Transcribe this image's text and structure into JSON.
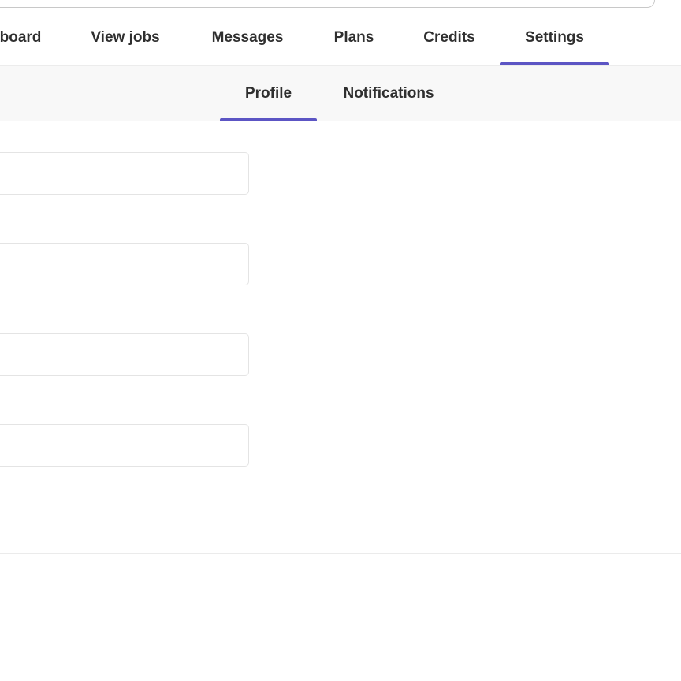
{
  "main_nav": {
    "tabs": [
      {
        "label": "board",
        "active": false
      },
      {
        "label": "View jobs",
        "active": false
      },
      {
        "label": "Messages",
        "active": false
      },
      {
        "label": "Plans",
        "active": false
      },
      {
        "label": "Credits",
        "active": false
      },
      {
        "label": "Settings",
        "active": true
      }
    ]
  },
  "sub_nav": {
    "tabs": [
      {
        "label": "Profile",
        "active": true
      },
      {
        "label": "Notifications",
        "active": false
      }
    ]
  },
  "form": {
    "fields": [
      {
        "value": "",
        "placeholder": ""
      },
      {
        "value": "",
        "placeholder": ""
      },
      {
        "value": "",
        "placeholder": ""
      },
      {
        "value": "",
        "placeholder": ""
      }
    ]
  },
  "colors": {
    "accent": "#5c55c4",
    "text": "#2f2f2f",
    "subnav_bg": "#f8f8f8",
    "field_border": "#e4e4e4"
  }
}
